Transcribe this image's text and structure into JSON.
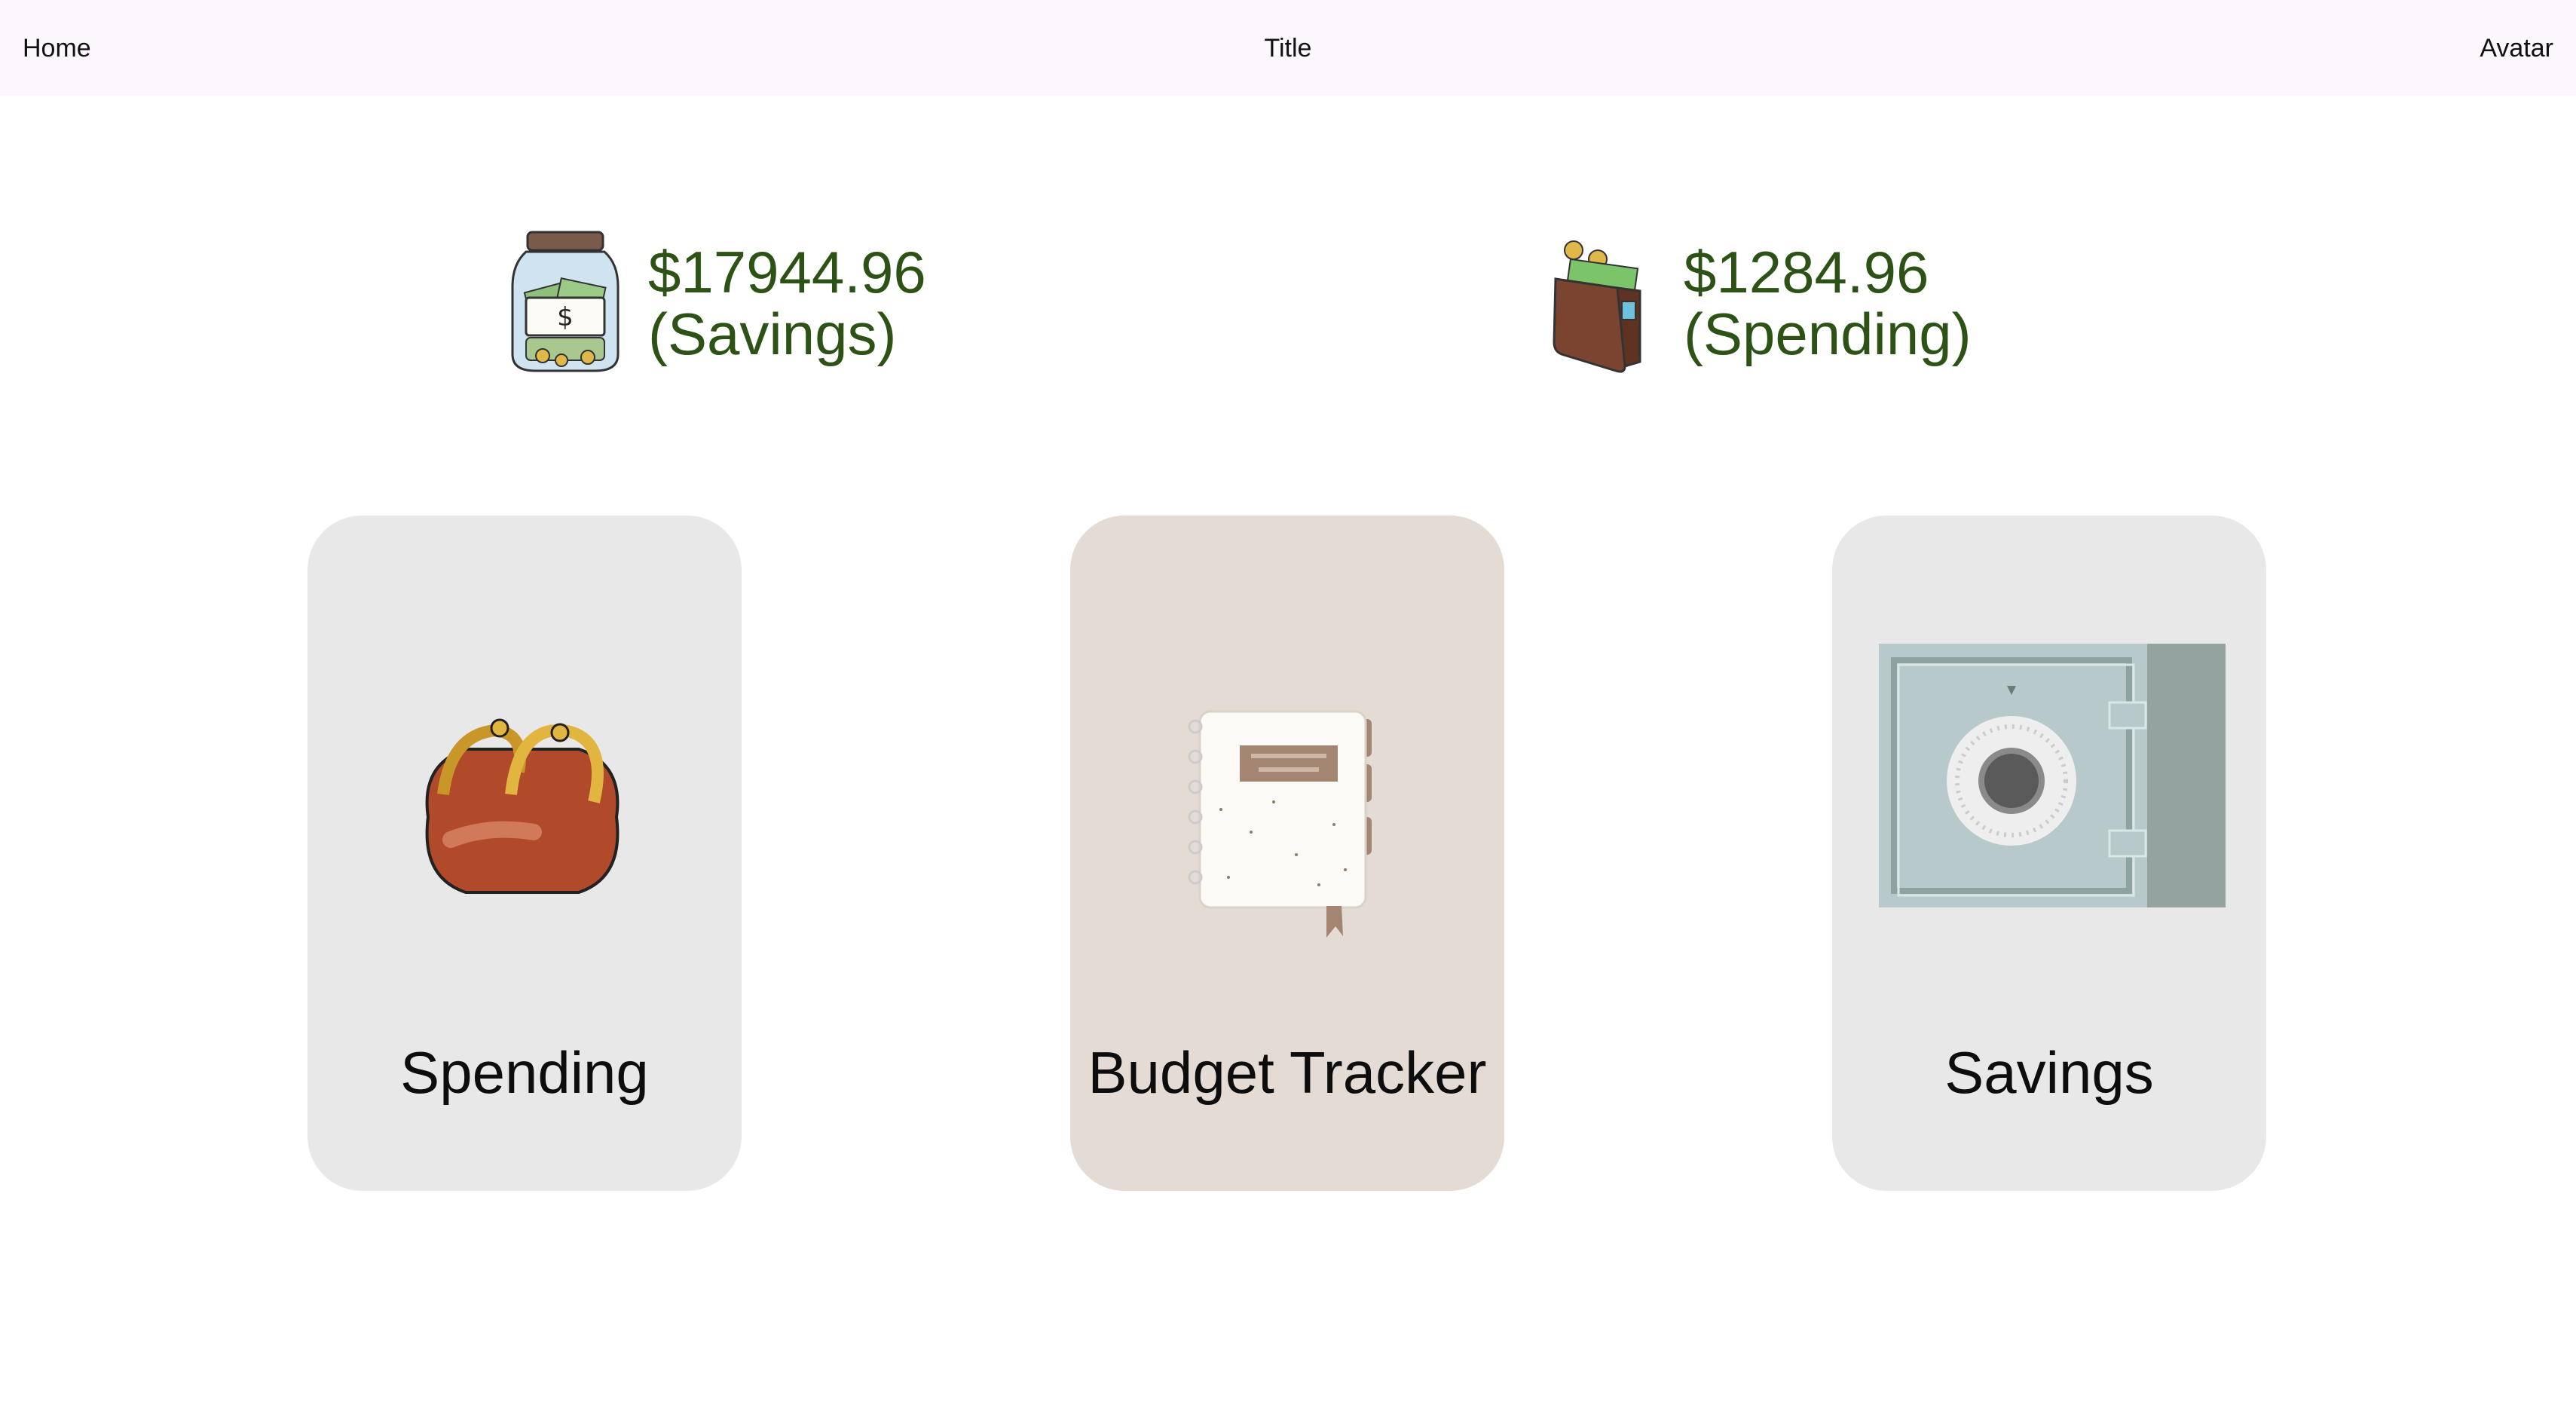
{
  "topbar": {
    "home": "Home",
    "title": "Title",
    "avatar": "Avatar"
  },
  "balances": {
    "savings": {
      "amount": "$17944.96",
      "label": "(Savings)",
      "icon": "savings-jar-icon"
    },
    "spending": {
      "amount": "$1284.96",
      "label": "(Spending)",
      "icon": "wallet-icon"
    }
  },
  "cards": {
    "spending": {
      "label": "Spending",
      "icon": "coin-purse-icon"
    },
    "budget": {
      "label": "Budget Tracker",
      "icon": "notebook-icon"
    },
    "savings": {
      "label": "Savings",
      "icon": "safe-icon"
    }
  },
  "colors": {
    "topbar_bg": "#fcf7fc",
    "balance_text": "#2c5215",
    "card_gray": "#e8e8e8",
    "card_beige": "#e3dbd4"
  }
}
